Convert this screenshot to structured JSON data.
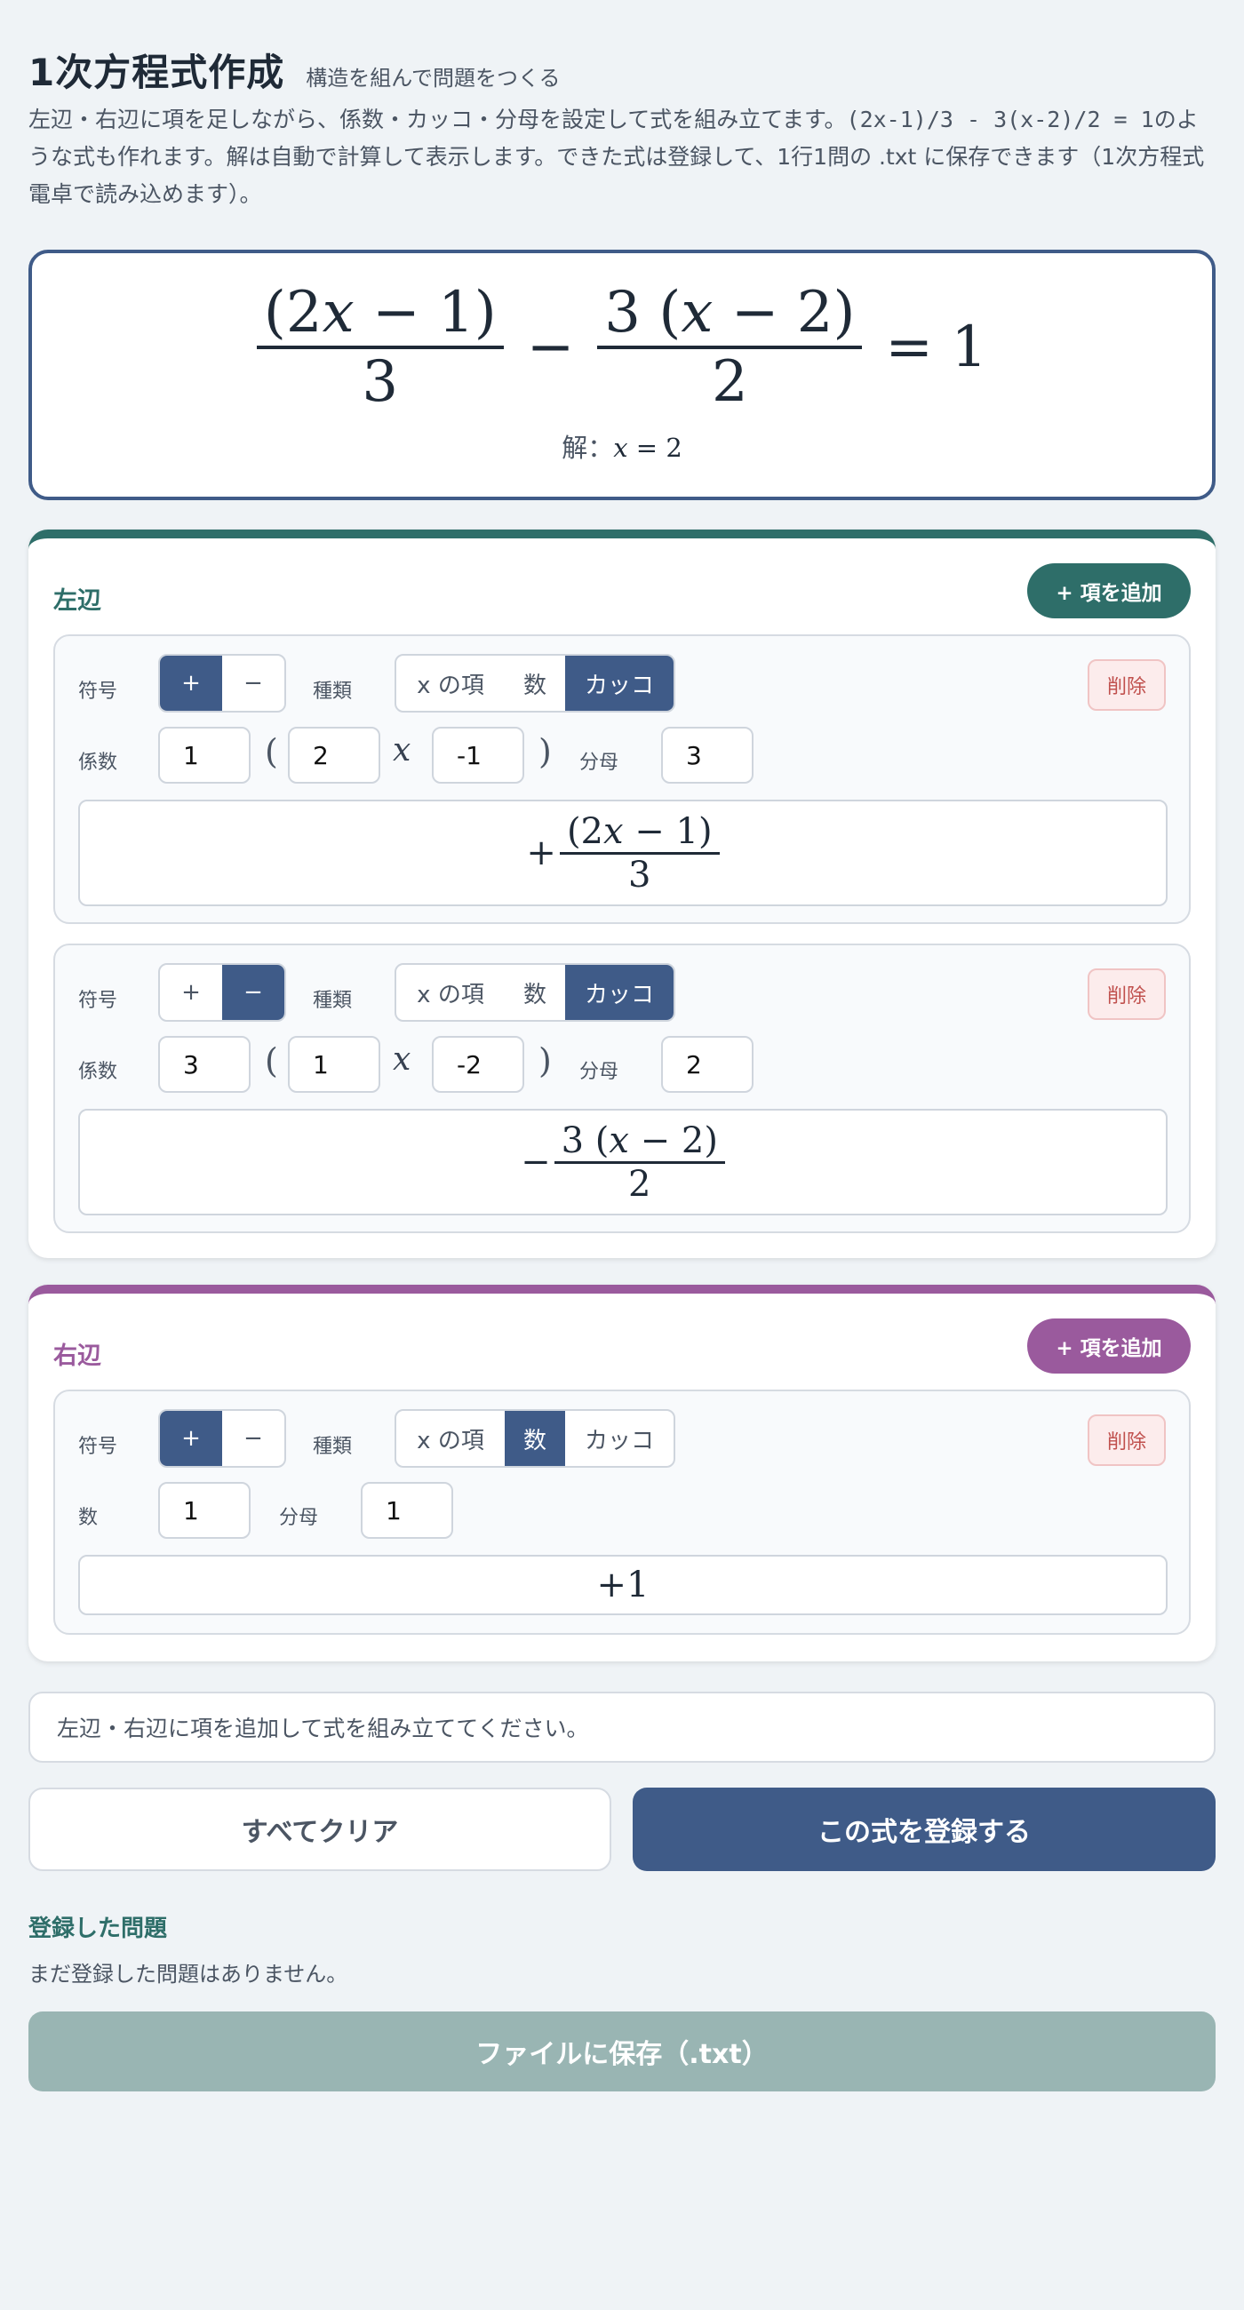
{
  "header": {
    "title": "1次方程式作成",
    "subtitle": "構造を組んで問題をつくる",
    "desc_1": "左辺・右辺に項を足しながら、係数・カッコ・分母を設定して式を組み立てます。",
    "desc_example": "(2x-1)/3 - 3(x-2)/2 = 1",
    "desc_2": "のような式も作れます。解は自動で計算して表示します。できた式は登録して、1行1問の .txt に保存できます（1次方程式電卓で読み込めます）。"
  },
  "preview": {
    "t1_num_open": "(2",
    "t1_num_var": "x",
    "t1_num_rest": " − 1)",
    "t1_den": "3",
    "op": "−",
    "t2_num_a": "3 (",
    "t2_num_var": "x",
    "t2_num_rest": " − 2)",
    "t2_den": "2",
    "equals_rhs": "= 1",
    "solution_label": "解：",
    "solution_var": "x",
    "solution_value": " = 2"
  },
  "left_side": {
    "title": "左辺",
    "add_label": "+ 項を追加",
    "terms": [
      {
        "sign_label": "符号",
        "plus": "+",
        "minus": "−",
        "type_label": "種類",
        "type_x": "x の項",
        "type_num": "数",
        "type_paren": "カッコ",
        "delete": "削除",
        "coef_label": "係数",
        "coef": "1",
        "open": "(",
        "inner_a": "2",
        "var": "x",
        "inner_b": "-1",
        "close": ")",
        "den_label": "分母",
        "den": "3",
        "prev_sign": "+",
        "prev_num_a": "(2",
        "prev_var": "x",
        "prev_num_b": " − 1)",
        "prev_den": "3"
      },
      {
        "sign_label": "符号",
        "plus": "+",
        "minus": "−",
        "type_label": "種類",
        "type_x": "x の項",
        "type_num": "数",
        "type_paren": "カッコ",
        "delete": "削除",
        "coef_label": "係数",
        "coef": "3",
        "open": "(",
        "inner_a": "1",
        "var": "x",
        "inner_b": "-2",
        "close": ")",
        "den_label": "分母",
        "den": "2",
        "prev_sign": "−",
        "prev_num_a": "3 (",
        "prev_var": "x",
        "prev_num_b": " − 2)",
        "prev_den": "2"
      }
    ]
  },
  "right_side": {
    "title": "右辺",
    "add_label": "+ 項を追加",
    "terms": [
      {
        "sign_label": "符号",
        "plus": "+",
        "minus": "−",
        "type_label": "種類",
        "type_x": "x の項",
        "type_num": "数",
        "type_paren": "カッコ",
        "delete": "削除",
        "num_label": "数",
        "num": "1",
        "den_label": "分母",
        "den": "1",
        "prev": "+1"
      }
    ]
  },
  "status": "左辺・右辺に項を追加して式を組み立ててください。",
  "buttons": {
    "clear": "すべてクリア",
    "register": "この式を登録する",
    "save": "ファイルに保存（.txt）"
  },
  "registered": {
    "title": "登録した問題",
    "empty": "まだ登録した問題はありません。"
  },
  "colors": {
    "primary": "#3f5b88",
    "left_accent": "#2e6e69",
    "right_accent": "#9a5a9d",
    "danger": "#c0504d"
  }
}
